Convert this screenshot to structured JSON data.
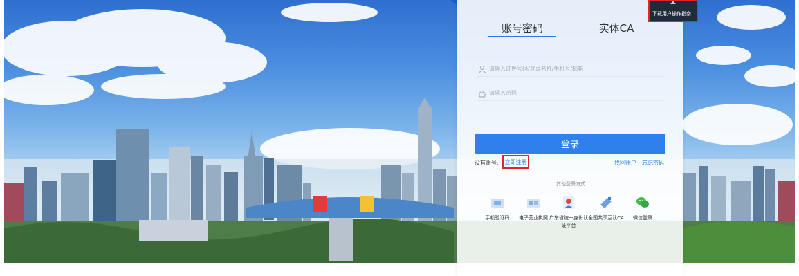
{
  "tabs": {
    "account_password": "账号密码",
    "physical_ca": "实体CA"
  },
  "guide": {
    "download_label": "下载用户操作指南"
  },
  "form": {
    "username_placeholder": "请输入证件号码/登录名称/手机号/邮箱",
    "password_placeholder": "请输入密码",
    "login_label": "登录"
  },
  "links": {
    "no_account": "没有账号,",
    "register": "立即注册",
    "find_account": "找回账户",
    "forget_password": "忘记密码"
  },
  "other_login": {
    "title": "其他登录方式",
    "methods": [
      {
        "label": "手机验证码",
        "icon": "phone-sms-icon"
      },
      {
        "label": "电子营业执照",
        "icon": "business-license-icon"
      },
      {
        "label": "广东省统一身份认证平台",
        "icon": "identity-platform-icon"
      },
      {
        "label": "全国共享互认CA",
        "icon": "ca-key-icon"
      },
      {
        "label": "微信登录",
        "icon": "wechat-icon"
      }
    ]
  },
  "colors": {
    "primary": "#2f80ed",
    "highlight_border": "#e0262a",
    "tab_underline": "#2b7be5"
  }
}
